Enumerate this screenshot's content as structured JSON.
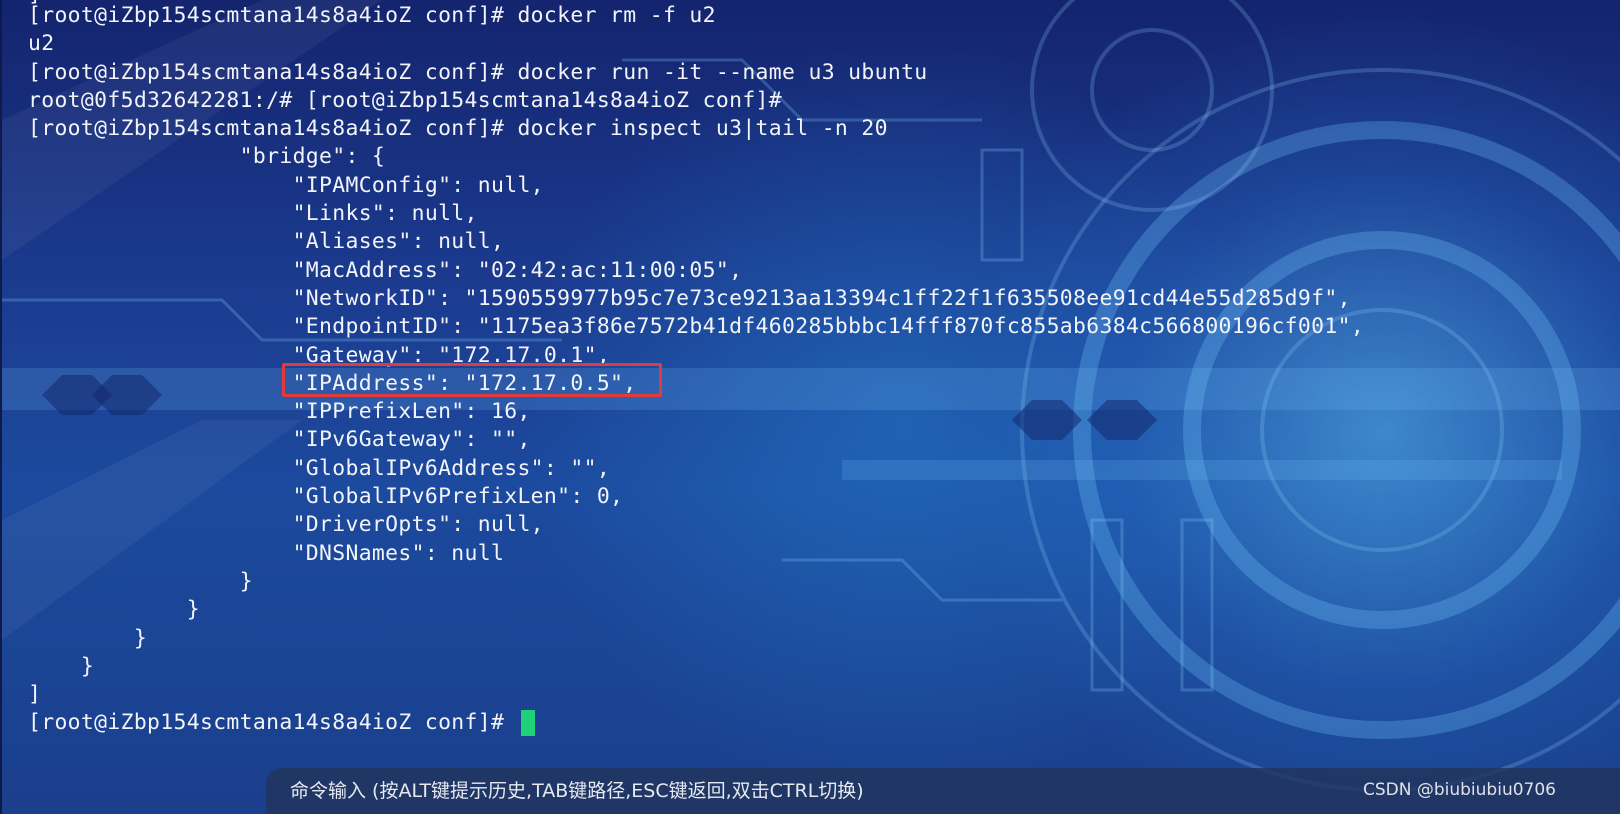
{
  "terminal": {
    "top_fragment": "]",
    "lines": [
      "[root@iZbp154scmtana14s8a4ioZ conf]# docker rm -f u2",
      "u2",
      "[root@iZbp154scmtana14s8a4ioZ conf]# docker run -it --name u3 ubuntu",
      "root@0f5d32642281:/# [root@iZbp154scmtana14s8a4ioZ conf]#",
      "[root@iZbp154scmtana14s8a4ioZ conf]# docker inspect u3|tail -n 20",
      "                \"bridge\": {",
      "                    \"IPAMConfig\": null,",
      "                    \"Links\": null,",
      "                    \"Aliases\": null,",
      "                    \"MacAddress\": \"02:42:ac:11:00:05\",",
      "                    \"NetworkID\": \"1590559977b95c7e73ce9213aa13394c1ff22f1f635508ee91cd44e55d285d9f\",",
      "                    \"EndpointID\": \"1175ea3f86e7572b41df460285bbbc14fff870fc855ab6384c566800196cf001\",",
      "                    \"Gateway\": \"172.17.0.1\",",
      "                    \"IPAddress\": \"172.17.0.5\",",
      "                    \"IPPrefixLen\": 16,",
      "                    \"IPv6Gateway\": \"\",",
      "                    \"GlobalIPv6Address\": \"\",",
      "                    \"GlobalIPv6PrefixLen\": 0,",
      "                    \"DriverOpts\": null,",
      "                    \"DNSNames\": null",
      "                }",
      "            }",
      "        }",
      "    }",
      "]"
    ],
    "prompt": "[root@iZbp154scmtana14s8a4ioZ conf]# "
  },
  "command_bar": {
    "hint": "命令输入 (按ALT键提示历史,TAB键路径,ESC键返回,双击CTRL切换)"
  },
  "watermark": "CSDN @biubiubiu0706",
  "colors": {
    "text": "#f2f4fa",
    "cursor": "#1fd27a",
    "highlight_border": "#e23a3a"
  }
}
